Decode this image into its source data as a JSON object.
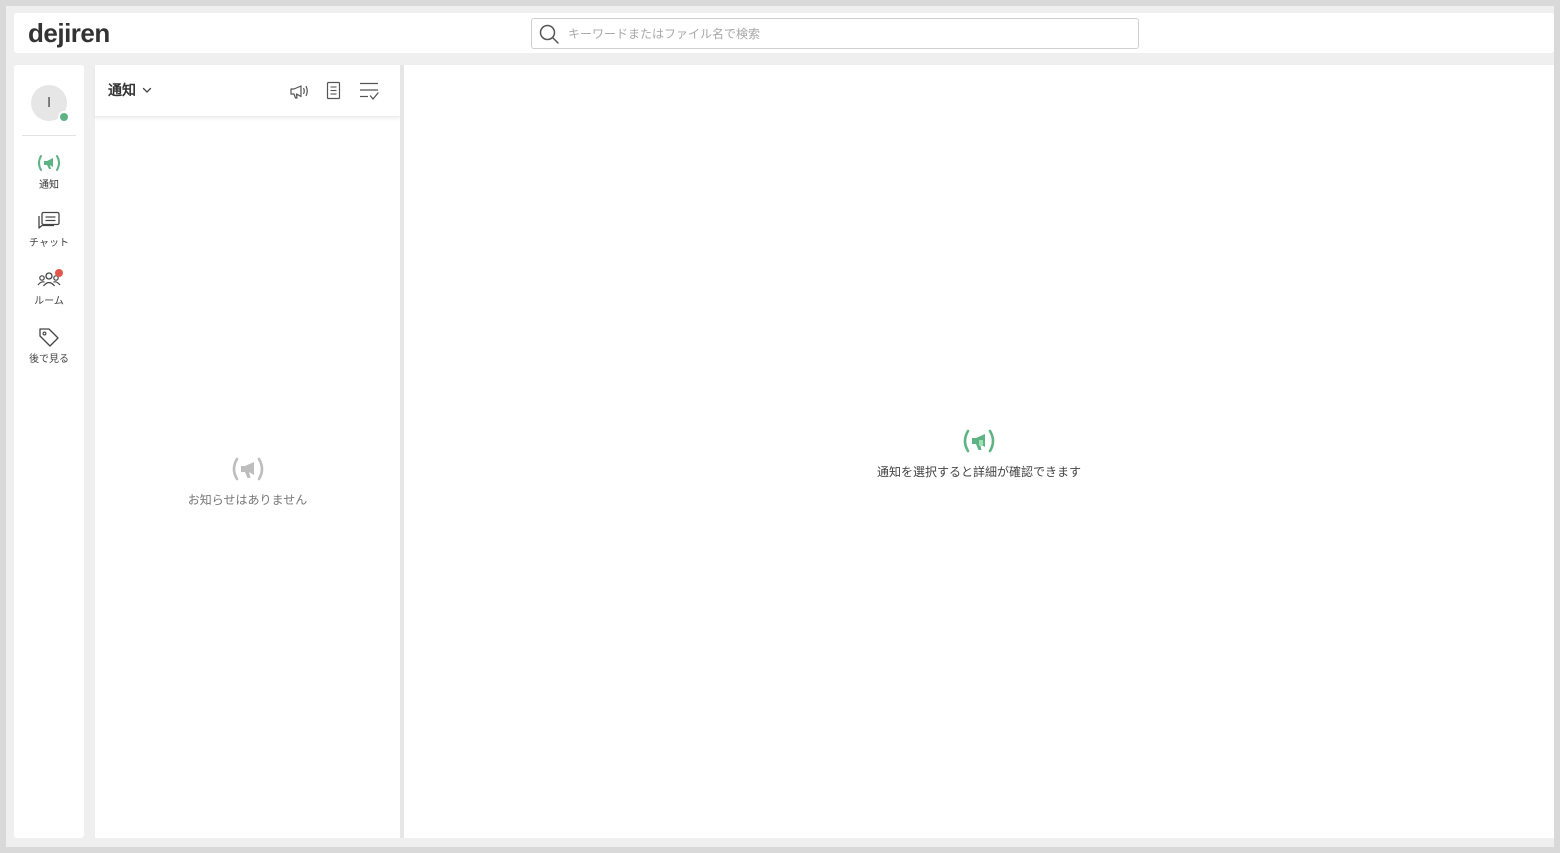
{
  "app": {
    "logo": "dejiren"
  },
  "search": {
    "placeholder": "キーワードまたはファイル名で検索",
    "value": ""
  },
  "user": {
    "initial": "I",
    "status": "online",
    "status_color": "#5db383"
  },
  "nav": {
    "items": [
      {
        "label": "通知",
        "icon": "megaphone-icon",
        "active": true
      },
      {
        "label": "チャット",
        "icon": "chat-icon",
        "active": false
      },
      {
        "label": "ルーム",
        "icon": "users-icon",
        "active": false,
        "has_badge": true
      },
      {
        "label": "後で見る",
        "icon": "tag-icon",
        "active": false
      }
    ]
  },
  "list": {
    "title": "通知",
    "empty_message": "お知らせはありません"
  },
  "detail": {
    "empty_message": "通知を選択すると詳細が確認できます"
  },
  "colors": {
    "accent": "#5db383",
    "badge": "#e0584c",
    "muted_icon": "#bdbdbd"
  }
}
